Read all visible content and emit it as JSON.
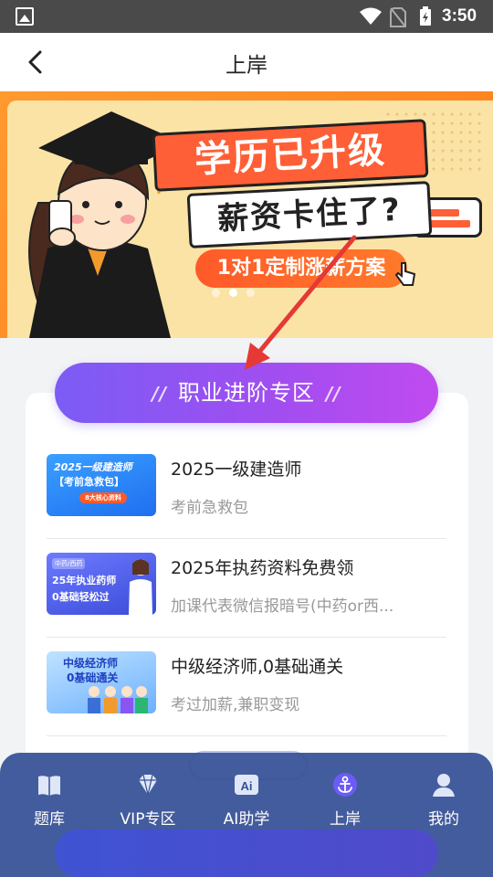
{
  "status_bar": {
    "time": "3:50"
  },
  "header": {
    "title": "上岸"
  },
  "banner": {
    "headline_1": "学历已升级",
    "headline_2": "薪资卡住了?",
    "subtitle": "1对1定制涨薪方案"
  },
  "zone": {
    "title": "职业进阶专区",
    "left_mark": "//",
    "right_mark": "//"
  },
  "items": [
    {
      "title": "2025一级建造师",
      "subtitle": "考前急救包",
      "thumb_line1": "2025一级建造师",
      "thumb_line2": "【考前急救包】",
      "thumb_line3": "8大核心资料"
    },
    {
      "title": "2025年执药资料免费领",
      "subtitle": "加课代表微信报暗号(中药or西...",
      "thumb_tag": "中药/西药",
      "thumb_line1": "25年执业药师",
      "thumb_line2": "0基础轻松过"
    },
    {
      "title": "中级经济师,0基础通关",
      "subtitle": "考过加薪,兼职变现",
      "thumb_line1": "中级经济师",
      "thumb_line2": "0基础通关"
    }
  ],
  "nav": [
    {
      "label": "题库",
      "icon": "book-icon"
    },
    {
      "label": "VIP专区",
      "icon": "diamond-icon"
    },
    {
      "label": "AI助学",
      "icon": "ai-icon"
    },
    {
      "label": "上岸",
      "icon": "anchor-icon",
      "active": true
    },
    {
      "label": "我的",
      "icon": "user-icon"
    }
  ],
  "colors": {
    "accent_purple": "#8a55f2",
    "banner_orange": "#ff7a1a",
    "nav_blue": "#355096",
    "arrow_red": "#e53935"
  }
}
